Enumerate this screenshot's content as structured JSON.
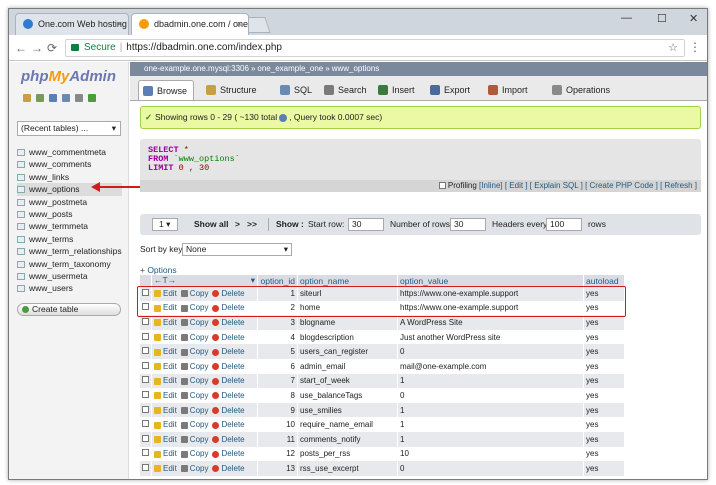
{
  "browser": {
    "tabs": [
      {
        "title": "One.com Web hosting",
        "close": "×"
      },
      {
        "title": "dbadmin.one.com / one",
        "close": "×"
      }
    ],
    "window_controls": {
      "min": "—",
      "max": "☐",
      "close": "✕"
    },
    "secure_label": "Secure",
    "url": "https://dbadmin.one.com/index.php"
  },
  "sidebar": {
    "logo": {
      "php": "php",
      "my": "My",
      "admin": "Admin"
    },
    "recent": "(Recent tables) ...",
    "tables": [
      "www_commentmeta",
      "www_comments",
      "www_links",
      "www_options",
      "www_postmeta",
      "www_posts",
      "www_termmeta",
      "www_terms",
      "www_term_relationships",
      "www_term_taxonomy",
      "www_usermeta",
      "www_users"
    ],
    "selected_index": 3,
    "create_table": "Create table"
  },
  "breadcrumb": {
    "server": "one-example.one.mysql:3306",
    "database": "one_example_one",
    "table": "www_options"
  },
  "tabs": [
    {
      "label": "Browse",
      "color": "#5a7fb0"
    },
    {
      "label": "Structure",
      "color": "#c8a040"
    },
    {
      "label": "SQL",
      "color": "#6a8ab0"
    },
    {
      "label": "Search",
      "color": "#7a7a7a"
    },
    {
      "label": "Insert",
      "color": "#3a7a3a"
    },
    {
      "label": "Export",
      "color": "#4a6a9a"
    },
    {
      "label": "Import",
      "color": "#b05a3a"
    },
    {
      "label": "Operations",
      "color": "#8a8a8a"
    }
  ],
  "success": {
    "text": "Showing rows 0 - 29 ( ~130 total",
    "text2": ", Query took 0.0007 sec)"
  },
  "sql": {
    "select": "SELECT",
    "star": "*",
    "from": "FROM",
    "table": "`www_options`",
    "limit": "LIMIT",
    "limit_vals": "0 , 30",
    "profiling": "Profiling",
    "links": [
      "[Inline]",
      "[ Edit ]",
      "[ Explain SQL ]",
      "[ Create PHP Code ]",
      "[ Refresh ]"
    ]
  },
  "pager": {
    "page": "1",
    "show_all": "Show all",
    "next": ">",
    "last": ">>",
    "show": "Show :",
    "start_row_label": "Start row:",
    "start_row": "30",
    "num_rows_label": "Number of rows:",
    "num_rows": "30",
    "headers_label": "Headers every",
    "headers_every": "100",
    "rows_label": "rows"
  },
  "sort": {
    "label": "Sort by key:",
    "value": "None"
  },
  "options_link": "+ Options",
  "columns": {
    "arrows": "←T→",
    "option_id": "option_id",
    "option_name": "option_name",
    "option_value": "option_value",
    "autoload": "autoload"
  },
  "actions": {
    "edit": "Edit",
    "copy": "Copy",
    "delete": "Delete"
  },
  "rows": [
    {
      "id": "1",
      "name": "siteurl",
      "value": "https://www.one-example.support",
      "autoload": "yes"
    },
    {
      "id": "2",
      "name": "home",
      "value": "https://www.one-example.support",
      "autoload": "yes"
    },
    {
      "id": "3",
      "name": "blogname",
      "value": "A WordPress Site",
      "autoload": "yes"
    },
    {
      "id": "4",
      "name": "blogdescription",
      "value": "Just another WordPress site",
      "autoload": "yes"
    },
    {
      "id": "5",
      "name": "users_can_register",
      "value": "0",
      "autoload": "yes"
    },
    {
      "id": "6",
      "name": "admin_email",
      "value": "mail@one-example.com",
      "autoload": "yes"
    },
    {
      "id": "7",
      "name": "start_of_week",
      "value": "1",
      "autoload": "yes"
    },
    {
      "id": "8",
      "name": "use_balanceTags",
      "value": "0",
      "autoload": "yes"
    },
    {
      "id": "9",
      "name": "use_smilies",
      "value": "1",
      "autoload": "yes"
    },
    {
      "id": "10",
      "name": "require_name_email",
      "value": "1",
      "autoload": "yes"
    },
    {
      "id": "11",
      "name": "comments_notify",
      "value": "1",
      "autoload": "yes"
    },
    {
      "id": "12",
      "name": "posts_per_rss",
      "value": "10",
      "autoload": "yes"
    },
    {
      "id": "13",
      "name": "rss_use_excerpt",
      "value": "0",
      "autoload": "yes"
    }
  ]
}
